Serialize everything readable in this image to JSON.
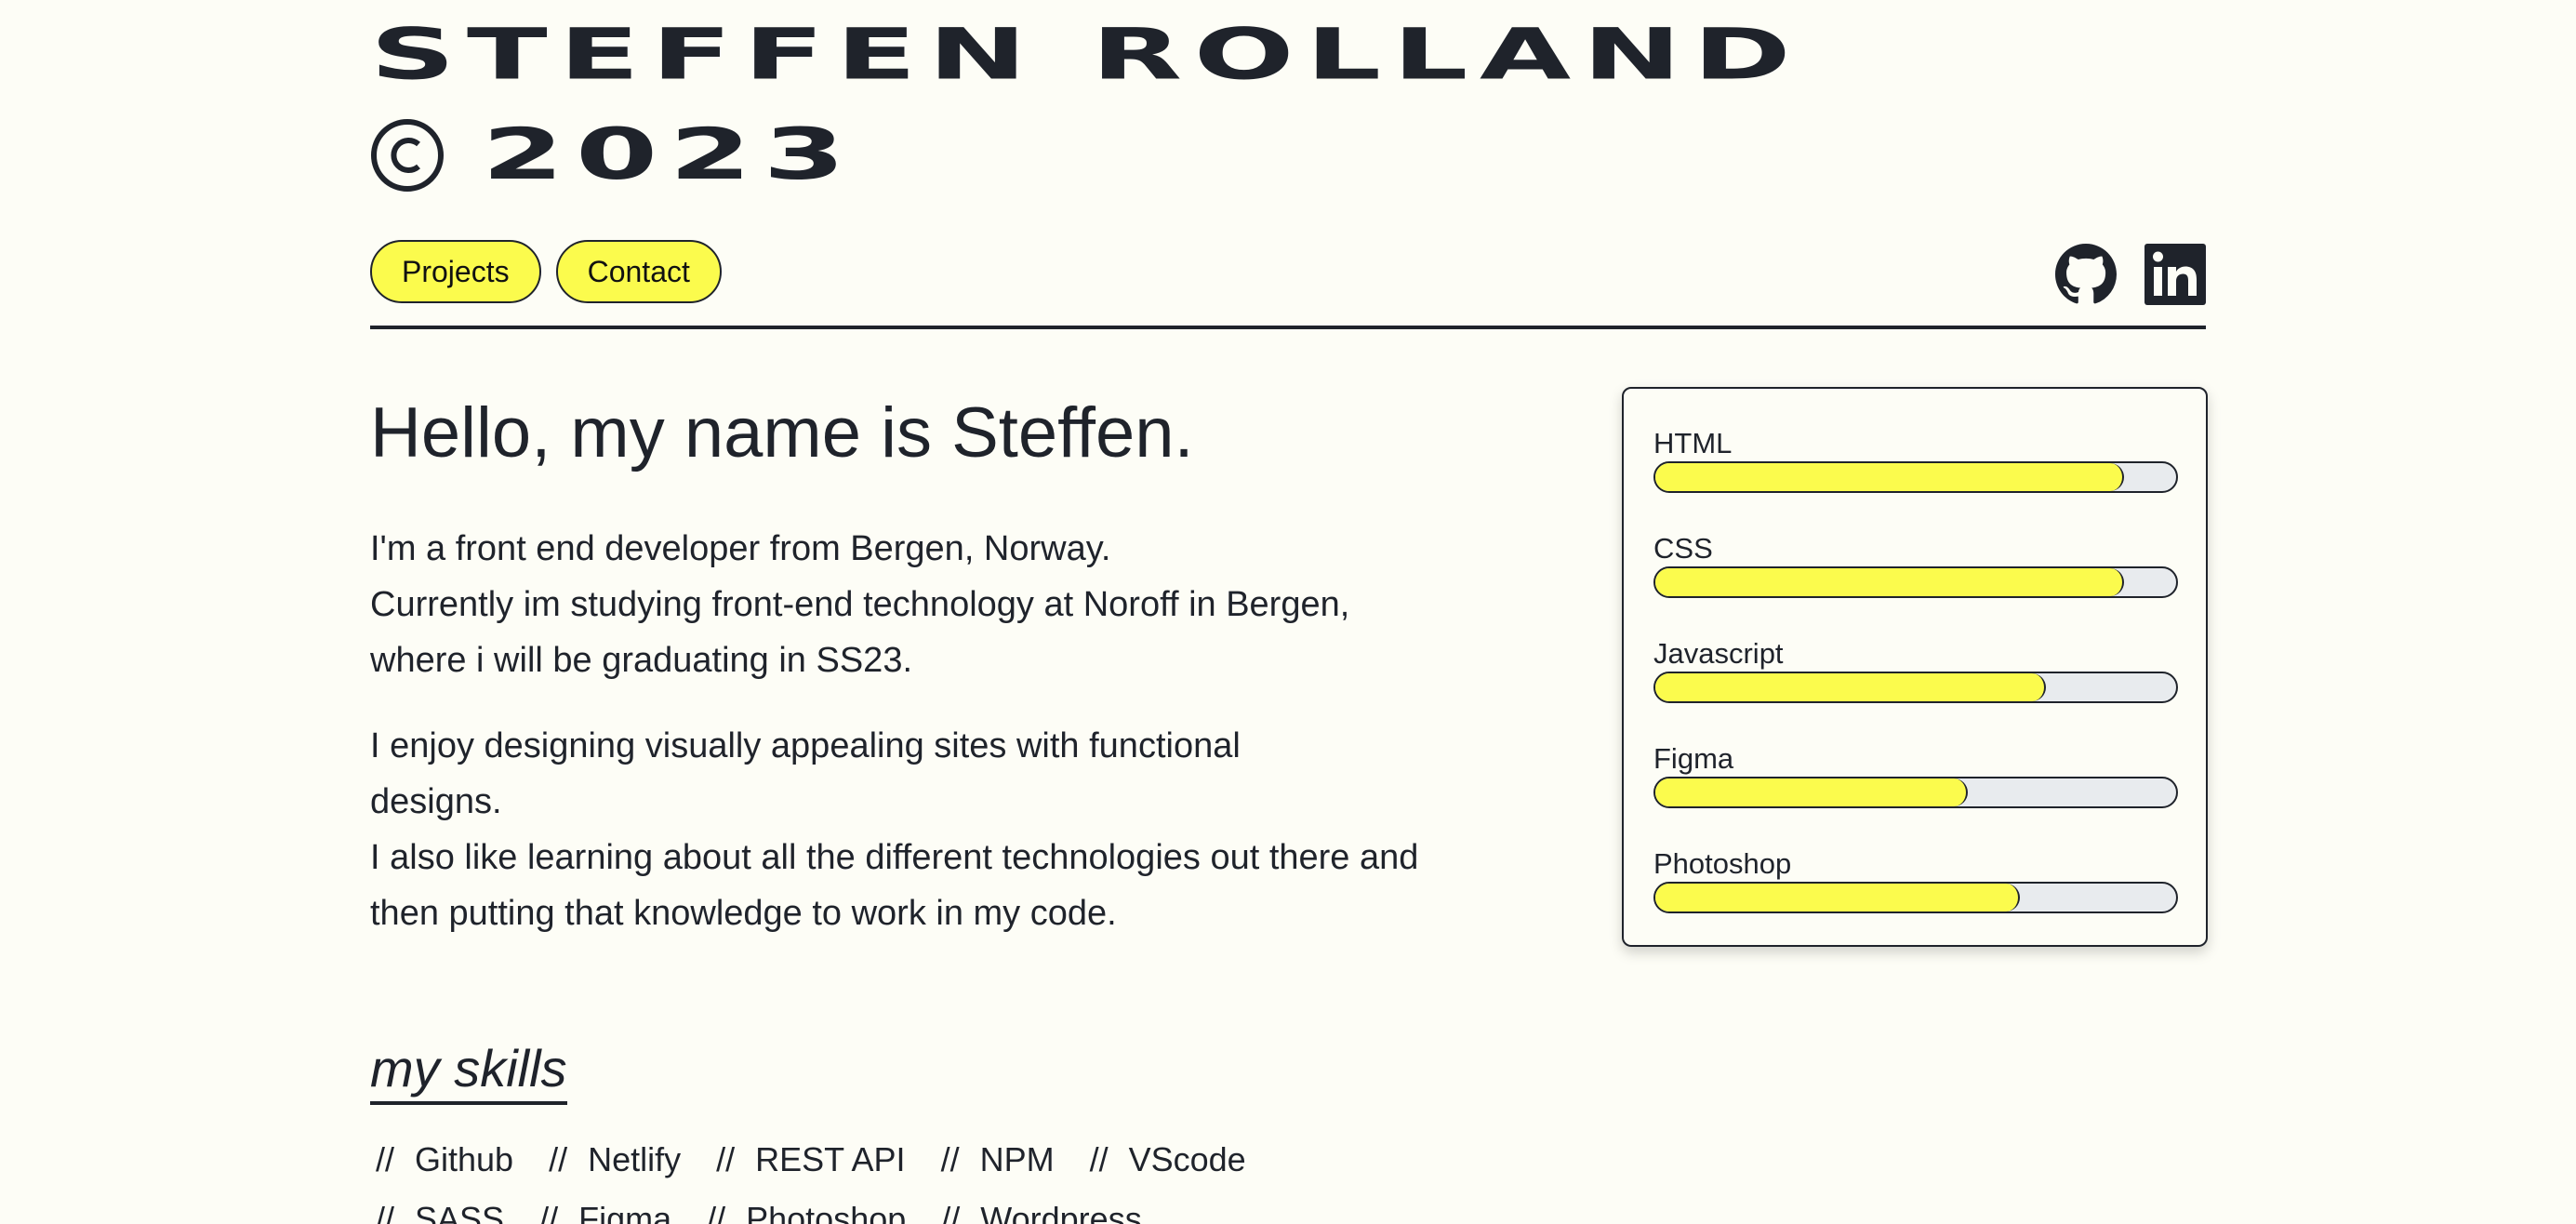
{
  "header": {
    "logo_line1": "STEFFEN ROLLAND",
    "logo_year": "2023",
    "copyright_icon": "copyright-icon"
  },
  "nav": {
    "projects_label": "Projects",
    "contact_label": "Contact"
  },
  "social": {
    "github_icon": "github-icon",
    "linkedin_icon": "linkedin-icon",
    "linkedin_text": "in"
  },
  "intro": {
    "greeting": "Hello, my name is Steffen.",
    "paragraph1": [
      "I'm a front end developer from Bergen, Norway.",
      "Currently im studying front-end technology at Noroff in Bergen, where i will be graduating in SS23."
    ],
    "paragraph2": [
      "I enjoy designing visually appealing sites with functional designs.",
      "I also like learning about all the different technologies out there and then putting that knowledge to work in my code."
    ]
  },
  "skills_card": {
    "skills": [
      {
        "name": "HTML",
        "level": 0.9
      },
      {
        "name": "CSS",
        "level": 0.9
      },
      {
        "name": "Javascript",
        "level": 0.75
      },
      {
        "name": "Figma",
        "level": 0.6
      },
      {
        "name": "Photoshop",
        "level": 0.7
      }
    ],
    "fill_color": "#fbfb4d",
    "track_color": "#e8ebee"
  },
  "my_skills": {
    "heading": "my skills",
    "separator": "//",
    "row1": [
      "Github",
      "Netlify",
      "REST API",
      "NPM",
      "VScode"
    ],
    "row2": [
      "SASS",
      "Figma",
      "Photoshop",
      "Wordpress"
    ]
  },
  "colors": {
    "background": "#fdfdf6",
    "text": "#1f232b",
    "accent": "#fbfb4d"
  }
}
